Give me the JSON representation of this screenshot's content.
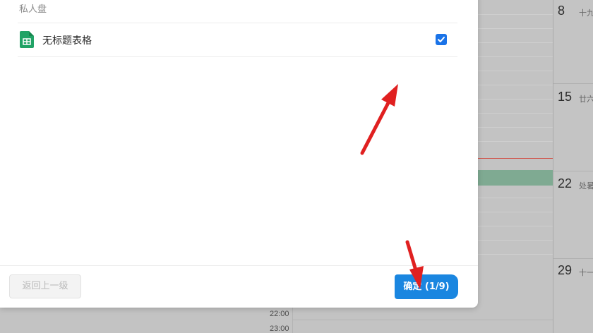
{
  "dialog": {
    "section_label": "私人盘",
    "file": {
      "name": "无标题表格",
      "checked": true,
      "icon": "spreadsheet-icon"
    },
    "back_label": "返回上一级",
    "confirm_label": "确定 (1/9)"
  },
  "calendar": {
    "times": [
      "22:00",
      "23:00"
    ],
    "days": [
      {
        "num": "8",
        "lunar": "十九"
      },
      {
        "num": "15",
        "lunar": "廿六"
      },
      {
        "num": "22",
        "lunar": "处暑"
      },
      {
        "num": "29",
        "lunar": "十一"
      }
    ]
  },
  "colors": {
    "accent": "#1a86e0",
    "sheet_green": "#21a366",
    "annotation_red": "#e02020",
    "event_green": "#7faa92"
  }
}
